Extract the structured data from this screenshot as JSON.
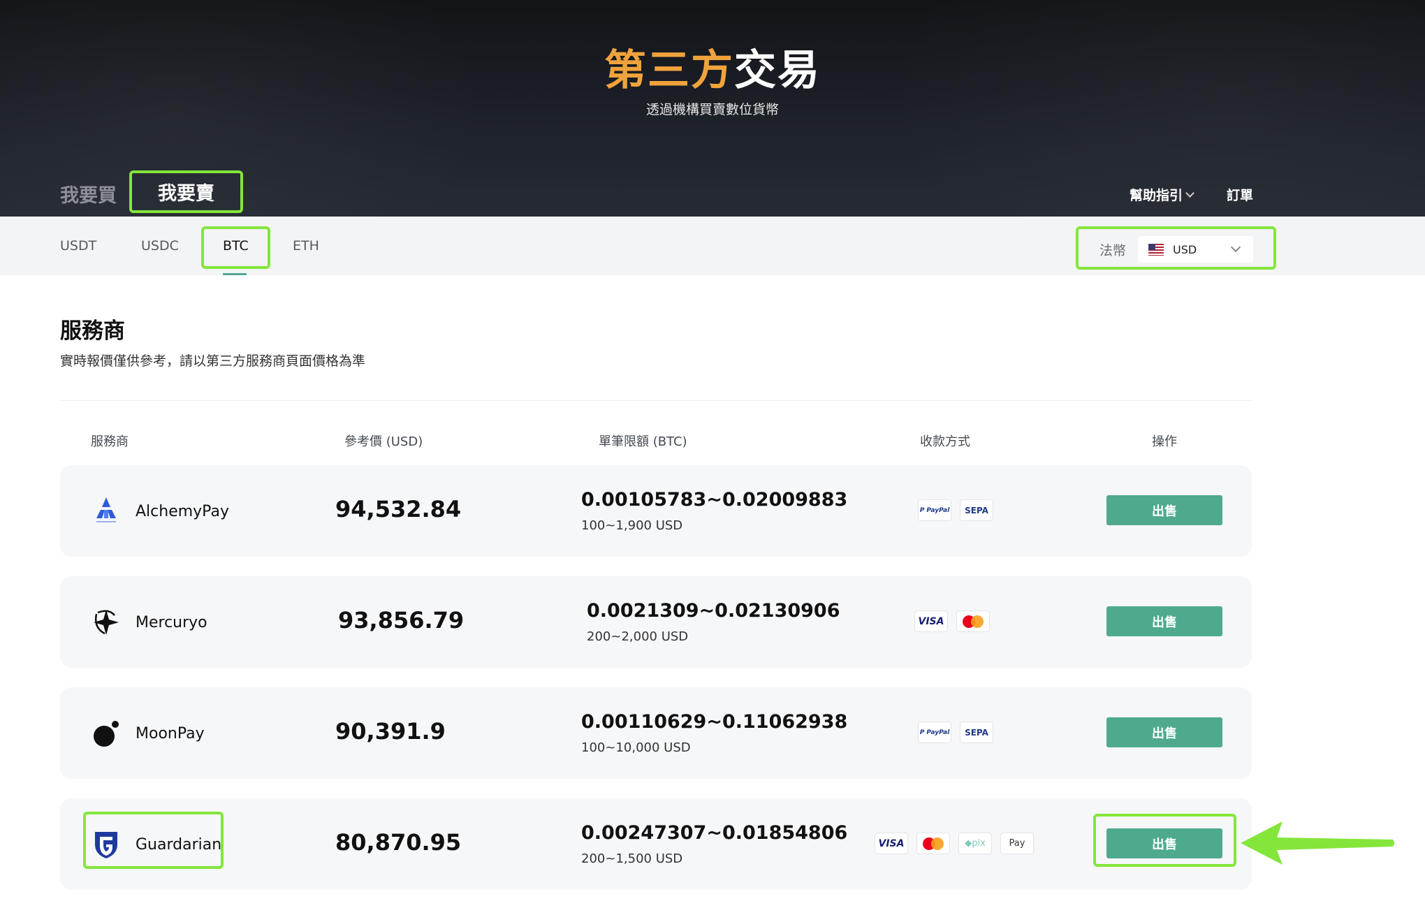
{
  "hero": {
    "title_accent": "第三方",
    "title_rest": "交易",
    "subtitle": "透過機構買賣數位貨幣"
  },
  "side_tabs": {
    "buy": "我要買",
    "sell": "我要賣",
    "active": "sell"
  },
  "header_links": {
    "help": "幫助指引",
    "orders": "訂單"
  },
  "coin_tabs": [
    "USDT",
    "USDC",
    "BTC",
    "ETH"
  ],
  "active_coin": "BTC",
  "fiat": {
    "label": "法幣",
    "value": "USD"
  },
  "section": {
    "title": "服務商",
    "subtitle": "實時報價僅供參考，請以第三方服務商頁面價格為準"
  },
  "columns": {
    "provider": "服務商",
    "price": "參考價 (USD)",
    "limit": "單筆限額 (BTC)",
    "payment": "收款方式",
    "action": "操作"
  },
  "providers": [
    {
      "name": "AlchemyPay",
      "logo": "alchemypay-logo",
      "price": "94,532.84",
      "limit_btc": "0.00105783~0.02009883",
      "limit_usd": "100~1,900 USD",
      "payments": [
        "PayPal",
        "SEPA"
      ],
      "action": "出售"
    },
    {
      "name": "Mercuryo",
      "logo": "mercuryo-logo",
      "price": "93,856.79",
      "limit_btc": "0.0021309~0.02130906",
      "limit_usd": "200~2,000 USD",
      "payments": [
        "VISA",
        "Mastercard"
      ],
      "action": "出售"
    },
    {
      "name": "MoonPay",
      "logo": "moonpay-logo",
      "price": "90,391.9",
      "limit_btc": "0.00110629~0.11062938",
      "limit_usd": "100~10,000 USD",
      "payments": [
        "PayPal",
        "SEPA"
      ],
      "action": "出售"
    },
    {
      "name": "Guardarian",
      "logo": "guardarian-logo",
      "price": "80,870.95",
      "limit_btc": "0.00247307~0.01854806",
      "limit_usd": "200~1,500 USD",
      "payments": [
        "VISA",
        "Mastercard",
        "pix",
        "Pay"
      ],
      "action": "出售"
    }
  ],
  "badge_text": {
    "paypal": "P PayPal",
    "sepa": "SEPA",
    "visa": "VISA",
    "pix": "◆pix",
    "rpay": "Pay"
  },
  "colors": {
    "accent_green": "#4fa98f",
    "highlight": "#84e63b",
    "title_orange": "#f0a33c"
  }
}
